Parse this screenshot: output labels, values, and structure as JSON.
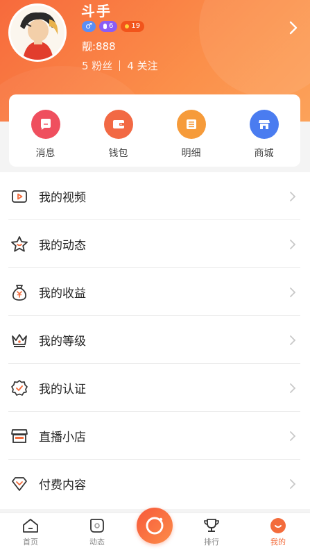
{
  "profile": {
    "nickname": "斗手",
    "gender_symbol": "♂",
    "level": "6",
    "coins": "19",
    "uid": "靓:888",
    "fans": "5 粉丝",
    "following": "4 关注"
  },
  "quick_actions": [
    {
      "label": "消息",
      "icon": "message-icon",
      "color": "#ef4f5e"
    },
    {
      "label": "钱包",
      "icon": "wallet-icon",
      "color": "#f26944"
    },
    {
      "label": "明细",
      "icon": "list-icon",
      "color": "#f69b3a"
    },
    {
      "label": "商城",
      "icon": "store-icon",
      "color": "#4a7cf0"
    }
  ],
  "menu": [
    {
      "label": "我的视频",
      "icon": "video-icon"
    },
    {
      "label": "我的动态",
      "icon": "star-icon"
    },
    {
      "label": "我的收益",
      "icon": "money-bag-icon"
    },
    {
      "label": "我的等级",
      "icon": "crown-icon"
    },
    {
      "label": "我的认证",
      "icon": "badge-check-icon"
    },
    {
      "label": "直播小店",
      "icon": "shop-icon"
    },
    {
      "label": "付费内容",
      "icon": "diamond-icon"
    }
  ],
  "tabbar": [
    {
      "label": "首页",
      "icon": "home-icon",
      "active": false
    },
    {
      "label": "动态",
      "icon": "feed-icon",
      "active": false
    },
    {
      "label": "排行",
      "icon": "trophy-icon",
      "active": false
    },
    {
      "label": "我的",
      "icon": "me-icon",
      "active": true
    }
  ],
  "colors": {
    "accent": "#f36c3c",
    "header_start": "#f76a3c",
    "header_end": "#fca25a"
  }
}
